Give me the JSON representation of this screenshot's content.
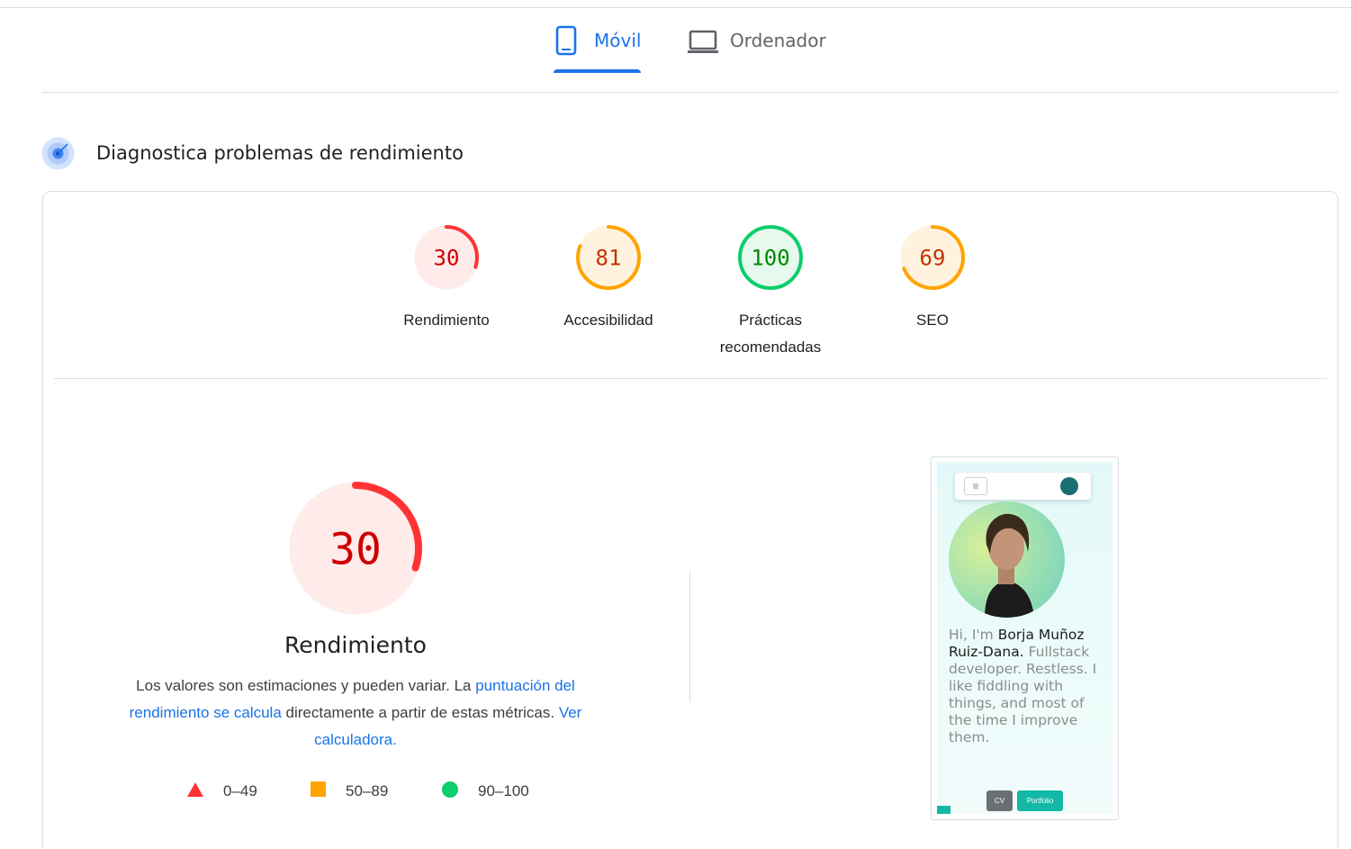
{
  "tabs": [
    {
      "label": "Móvil",
      "icon": "phone-icon",
      "active": true
    },
    {
      "label": "Ordenador",
      "icon": "laptop-icon",
      "active": false
    }
  ],
  "section": {
    "title": "Diagnostica problemas de rendimiento",
    "icon": "diagnostics-icon"
  },
  "gauges": [
    {
      "score": "30",
      "label": "Rendimiento",
      "rating": "fail",
      "fraction": 0.3
    },
    {
      "score": "81",
      "label": "Accesibilidad",
      "rating": "average",
      "fraction": 0.81
    },
    {
      "score": "100",
      "label": "Prácticas recomendadas",
      "rating": "pass",
      "fraction": 1.0
    },
    {
      "score": "69",
      "label": "SEO",
      "rating": "average",
      "fraction": 0.69
    }
  ],
  "performance": {
    "score": "30",
    "fraction": 0.3,
    "title": "Rendimiento",
    "desc_before": "Los valores son estimaciones y pueden variar. La ",
    "desc_link1": "puntuación del rendimiento se calcula",
    "desc_middle": " directamente a partir de estas métricas. ",
    "desc_link2": "Ver calculadora."
  },
  "legend": [
    {
      "range": "0–49",
      "shape": "triangle",
      "color": "#ff3333"
    },
    {
      "range": "50–89",
      "shape": "square",
      "color": "#ffa400"
    },
    {
      "range": "90–100",
      "shape": "circle",
      "color": "#0cce6b"
    }
  ],
  "colors": {
    "fail": "#ff3333",
    "fail_text": "#c00",
    "fail_bg": "#ffebea",
    "average": "#ffa400",
    "average_text": "#c33300",
    "average_bg": "#fff3e0",
    "pass": "#0cce6b",
    "pass_text": "#008800",
    "pass_bg": "#e6f9ec",
    "accent": "#1a73e8"
  },
  "screenshot": {
    "text_intro": "Hi, I'm ",
    "name": "Borja Muñoz Ruiz-Dana.",
    "text_rest": " Fullstack developer. Restless. I like fiddling with things, and most of the time I improve them.",
    "cv_button": "CV",
    "portfolio_button": "Portfolio"
  }
}
